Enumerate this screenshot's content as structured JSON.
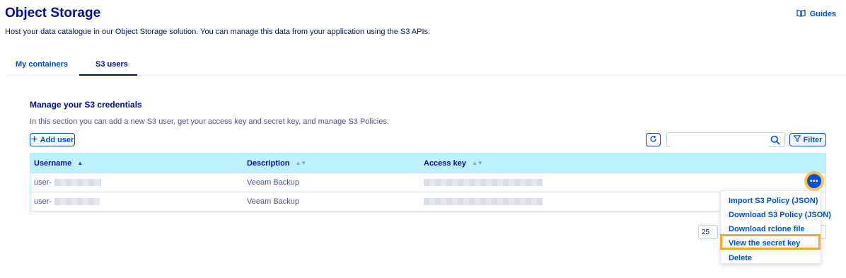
{
  "header": {
    "title": "Object Storage",
    "subtitle": "Host your data catalogue in our Object Storage solution. You can manage this data from your application using the S3 APIs.",
    "guides_label": "Guides"
  },
  "tabs": [
    {
      "label": "My containers",
      "active": false
    },
    {
      "label": "S3 users",
      "active": true
    }
  ],
  "section": {
    "title": "Manage your S3 credentials",
    "description": "In this section you can add a new S3 user, get your access key and secret key, and manage S3 Policies."
  },
  "toolbar": {
    "add_user_label": "Add user",
    "search_placeholder": "",
    "filter_label": "Filter"
  },
  "table": {
    "columns": [
      "Username",
      "Description",
      "Access key"
    ],
    "rows": [
      {
        "username": "user-",
        "description": "Veeam Backup"
      },
      {
        "username": "user-",
        "description": "Veeam Backup"
      }
    ]
  },
  "pagination": {
    "page_size": "25"
  },
  "action_menu": {
    "items": [
      "Import S3 Policy (JSON)",
      "Download S3 Policy (JSON)",
      "Download rclone file",
      "View the secret key",
      "Delete"
    ],
    "highlighted": "View the secret key"
  },
  "colors": {
    "primary": "#0050d7",
    "heading": "#000e9c",
    "table_header": "#bef1ff",
    "highlight": "#ffa726"
  }
}
